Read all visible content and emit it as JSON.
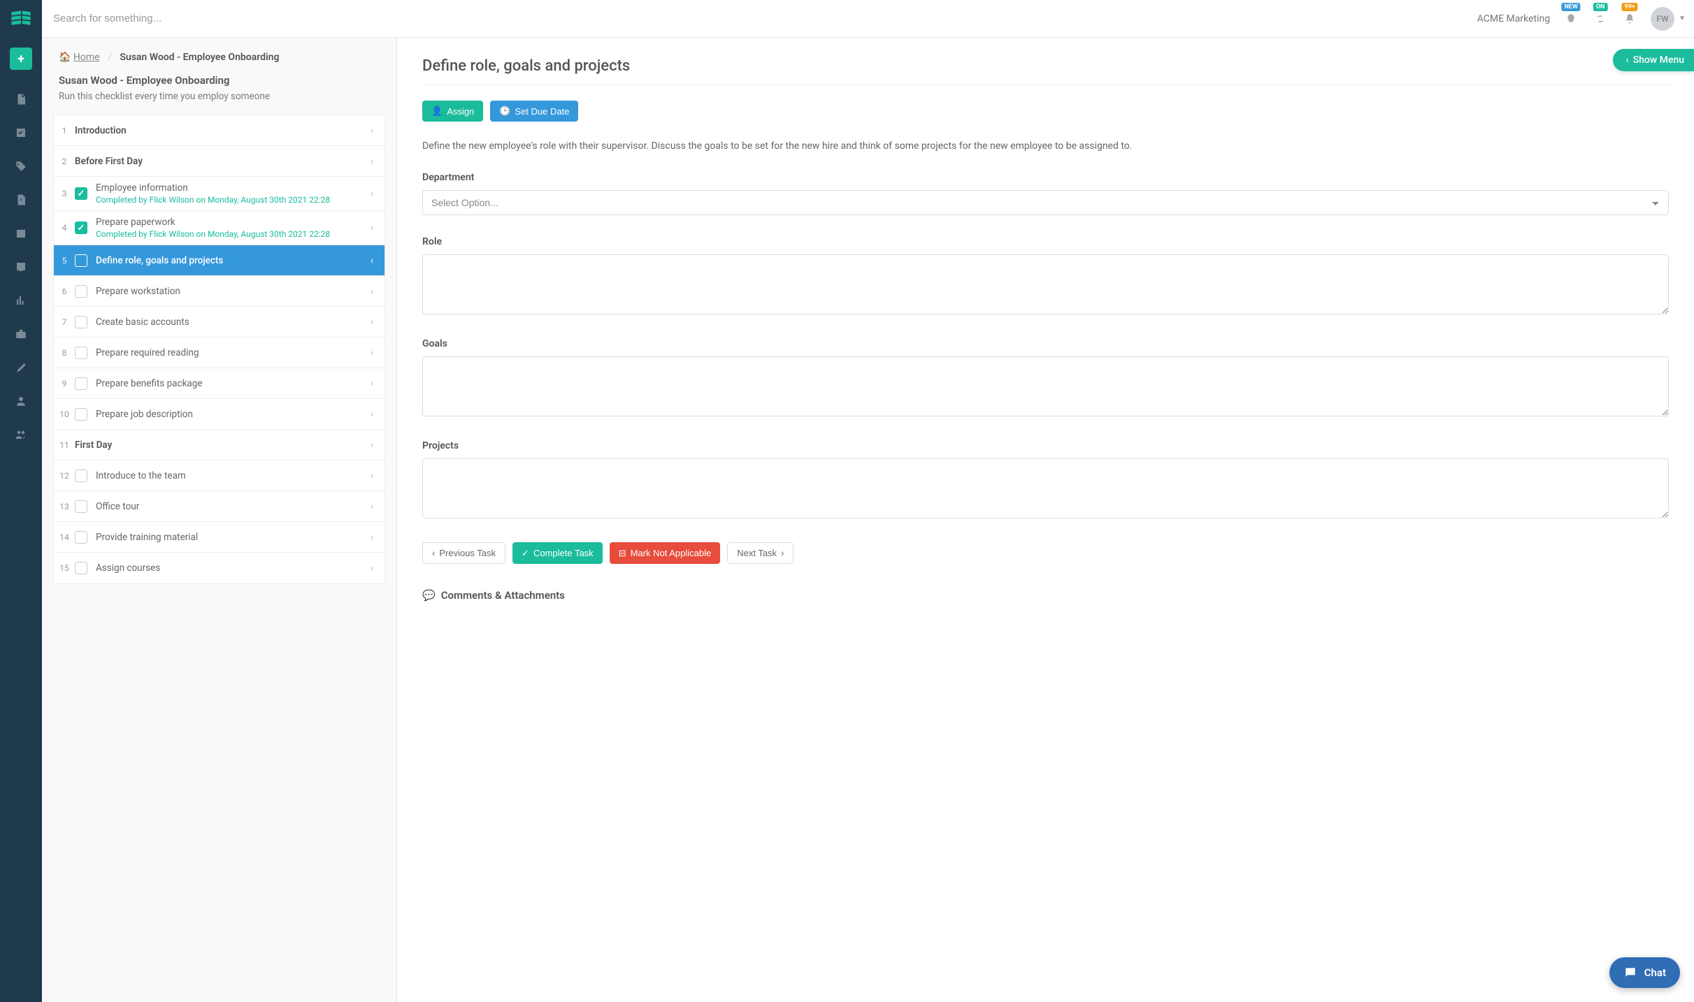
{
  "topbar": {
    "search_placeholder": "Search for something...",
    "org_name": "ACME Marketing",
    "badge_new": "NEW",
    "badge_on": "ON",
    "badge_notif": "99+",
    "avatar_initials": "FW"
  },
  "breadcrumb": {
    "home": "Home",
    "current": "Susan Wood - Employee Onboarding"
  },
  "checklist": {
    "title": "Susan Wood - Employee Onboarding",
    "subtitle": "Run this checklist every time you employ someone",
    "tasks": [
      {
        "n": "1",
        "type": "section",
        "title": "Introduction"
      },
      {
        "n": "2",
        "type": "section",
        "title": "Before First Day"
      },
      {
        "n": "3",
        "type": "item",
        "done": true,
        "title": "Employee information",
        "meta": "Completed by Flick Wilson on Monday, August 30th 2021 22:28"
      },
      {
        "n": "4",
        "type": "item",
        "done": true,
        "title": "Prepare paperwork",
        "meta": "Completed by Flick Wilson on Monday, August 30th 2021 22:28"
      },
      {
        "n": "5",
        "type": "item",
        "active": true,
        "title": "Define role, goals and projects"
      },
      {
        "n": "6",
        "type": "item",
        "title": "Prepare workstation"
      },
      {
        "n": "7",
        "type": "item",
        "title": "Create basic accounts"
      },
      {
        "n": "8",
        "type": "item",
        "title": "Prepare required reading"
      },
      {
        "n": "9",
        "type": "item",
        "title": "Prepare benefits package"
      },
      {
        "n": "10",
        "type": "item",
        "title": "Prepare job description"
      },
      {
        "n": "11",
        "type": "section",
        "title": "First Day"
      },
      {
        "n": "12",
        "type": "item",
        "title": "Introduce to the team"
      },
      {
        "n": "13",
        "type": "item",
        "title": "Office tour"
      },
      {
        "n": "14",
        "type": "item",
        "title": "Provide training material"
      },
      {
        "n": "15",
        "type": "item",
        "title": "Assign courses"
      }
    ]
  },
  "detail": {
    "title": "Define role, goals and projects",
    "assign_label": "Assign",
    "due_label": "Set Due Date",
    "description": "Define the new employee's role with their supervisor. Discuss the goals to be set for the new hire and think of some projects for the new employee to be assigned to.",
    "fields": {
      "department_label": "Department",
      "department_placeholder": "Select Option...",
      "role_label": "Role",
      "goals_label": "Goals",
      "projects_label": "Projects"
    },
    "nav": {
      "prev": "Previous Task",
      "complete": "Complete Task",
      "na": "Mark Not Applicable",
      "next": "Next Task"
    },
    "comments_header": "Comments & Attachments"
  },
  "show_menu_label": "Show Menu",
  "chat_label": "Chat"
}
